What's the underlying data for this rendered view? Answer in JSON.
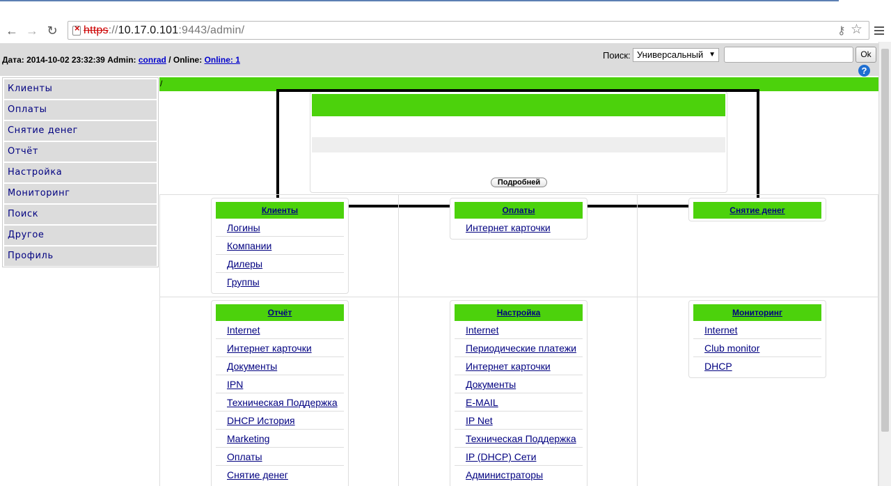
{
  "browser": {
    "url_scheme": "https",
    "url_host": "10.17.0.101",
    "url_rest": ":9443/admin/"
  },
  "header": {
    "date_label": "Дата: 2014-10-02 23:32:39 Admin:",
    "admin_name": "conrad",
    "online_label": "/ Online:",
    "online_link": "Online: 1",
    "search_label": "Поиск:",
    "search_select": "Универсальный",
    "search_value": "",
    "ok_label": "Ok",
    "help": "?"
  },
  "sidebar": {
    "items": [
      {
        "label": "Клиенты"
      },
      {
        "label": "Оплаты"
      },
      {
        "label": "Снятие денег"
      },
      {
        "label": "Отчёт"
      },
      {
        "label": "Настройка"
      },
      {
        "label": "Мониторинг"
      },
      {
        "label": "Поиск"
      },
      {
        "label": "Другое"
      },
      {
        "label": "Профиль"
      }
    ]
  },
  "main": {
    "breadcrumb": "/",
    "news_more": "Подробней",
    "panels": [
      {
        "title": "Клиенты",
        "links": [
          "Логины",
          "Компании",
          "Дилеры",
          "Группы"
        ]
      },
      {
        "title": "Оплаты",
        "links": [
          "Интернет карточки"
        ]
      },
      {
        "title": "Снятие денег",
        "links": []
      },
      {
        "title": "Отчёт",
        "links": [
          "Internet",
          "Интернет карточки",
          "Документы",
          "IPN",
          "Техническая Поддержка",
          "DHCP История",
          "Marketing",
          "Оплаты",
          "Снятие денег"
        ]
      },
      {
        "title": "Настройка",
        "links": [
          "Internet",
          "Периодические платежи",
          "Интернет карточки",
          "Документы",
          "E-MAIL",
          "IP Net",
          "Техническая Поддержка",
          "IP (DHCP) Сети",
          "Администраторы"
        ]
      },
      {
        "title": "Мониторинг",
        "links": [
          "Internet",
          "Club monitor",
          "DHCP"
        ]
      }
    ]
  }
}
